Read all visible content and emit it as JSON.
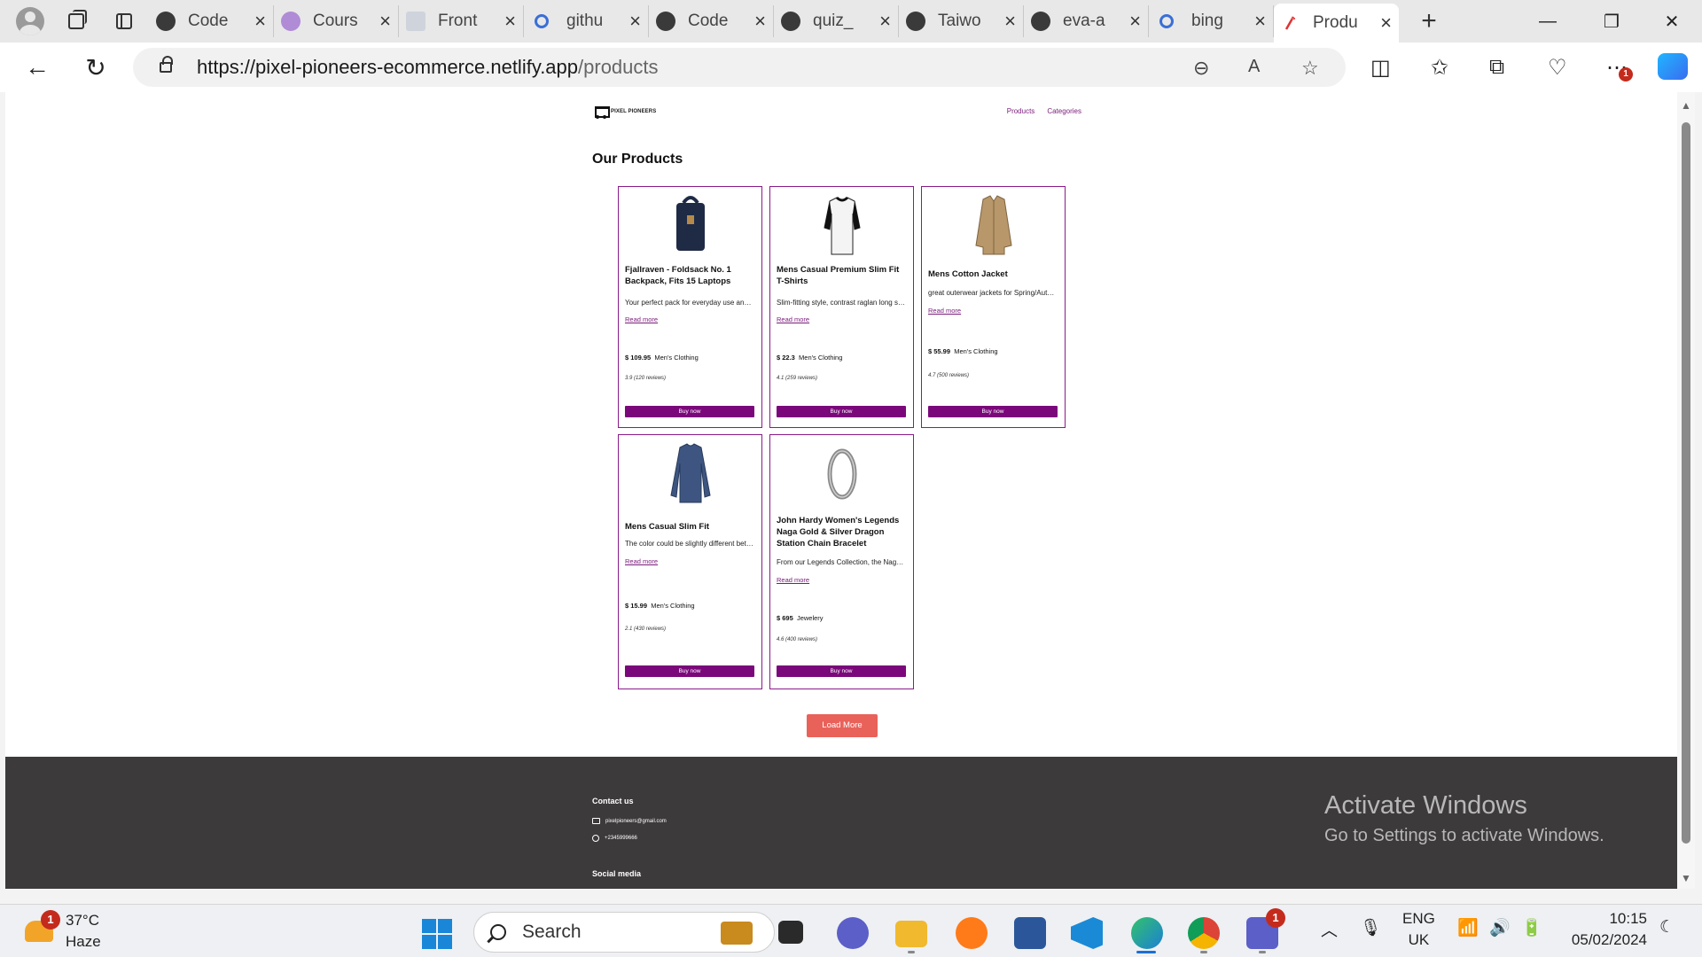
{
  "browser": {
    "tabs": [
      {
        "title": "Code",
        "favicon": "github-icon"
      },
      {
        "title": "Cours",
        "favicon": "course-icon"
      },
      {
        "title": "Front",
        "favicon": "document-icon"
      },
      {
        "title": "githu",
        "favicon": "search-icon"
      },
      {
        "title": "Code",
        "favicon": "github-icon"
      },
      {
        "title": "quiz_",
        "favicon": "github-icon"
      },
      {
        "title": "Taiwo",
        "favicon": "github-icon"
      },
      {
        "title": "eva-a",
        "favicon": "github-icon"
      },
      {
        "title": "bing",
        "favicon": "search-icon"
      },
      {
        "title": "Produ",
        "favicon": "page-icon",
        "active": true
      }
    ],
    "url_host": "https://pixel-pioneers-ecommerce.netlify.app",
    "url_path": "/products",
    "notification_count": "1"
  },
  "site": {
    "logo_text": "PIXEL PIONEERS",
    "nav": {
      "products": "Products",
      "categories": "Categories"
    },
    "page_title": "Our Products",
    "read_more": "Read more",
    "buy_label": "Buy now",
    "load_more": "Load More",
    "accent_color": "#7b087b",
    "load_more_color": "#e8625a",
    "products": [
      {
        "name": "Fjallraven - Foldsack No. 1 Backpack, Fits 15 Laptops",
        "description": "Your perfect pack for everyday use and walks in the forest",
        "price": "$ 109.95",
        "category": "Men's Clothing",
        "rating": "3.9",
        "reviews": "(120 reviews)"
      },
      {
        "name": "Mens Casual Premium Slim Fit T-Shirts",
        "description": "Slim-fitting style, contrast raglan long sleeve",
        "price": "$ 22.3",
        "category": "Men's Clothing",
        "rating": "4.1",
        "reviews": "(259 reviews)"
      },
      {
        "name": "Mens Cotton Jacket",
        "description": "great outerwear jackets for Spring/Autumn/Winter",
        "price": "$ 55.99",
        "category": "Men's Clothing",
        "rating": "4.7",
        "reviews": "(500 reviews)"
      },
      {
        "name": "Mens Casual Slim Fit",
        "description": "The color could be slightly different between on the screen",
        "price": "$ 15.99",
        "category": "Men's Clothing",
        "rating": "2.1",
        "reviews": "(430 reviews)"
      },
      {
        "name": "John Hardy Women's Legends Naga Gold & Silver Dragon Station Chain Bracelet",
        "description": "From our Legends Collection, the Naga was inspired by",
        "price": "$ 695",
        "category": "Jewelery",
        "rating": "4.6",
        "reviews": "(400 reviews)"
      }
    ],
    "footer": {
      "contact_heading": "Contact us",
      "email": "pixelpioneers@gmail.com",
      "phone": "+2345999666",
      "social_heading": "Social media"
    }
  },
  "watermark": {
    "line1": "Activate Windows",
    "line2": "Go to Settings to activate Windows."
  },
  "taskbar": {
    "weather_temp": "37°C",
    "weather_desc": "Haze",
    "weather_badge": "1",
    "search_placeholder": "Search",
    "teams_badge": "1",
    "lang_line1": "ENG",
    "lang_line2": "UK",
    "time": "10:15",
    "date": "05/02/2024"
  }
}
